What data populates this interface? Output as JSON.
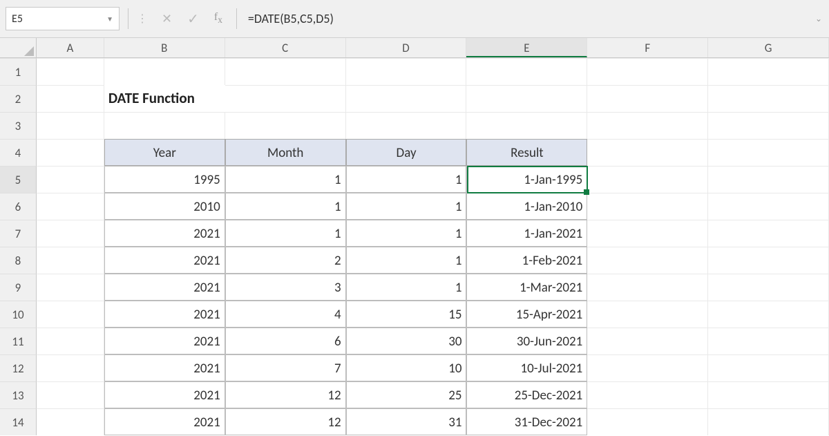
{
  "formula_bar": {
    "cell_reference": "E5",
    "formula": "=DATE(B5,C5,D5)"
  },
  "columns": [
    "A",
    "B",
    "C",
    "D",
    "E",
    "F",
    "G"
  ],
  "row_numbers": [
    "1",
    "2",
    "3",
    "4",
    "5",
    "6",
    "7",
    "8",
    "9",
    "10",
    "11",
    "12",
    "13",
    "14"
  ],
  "selected": {
    "col": "E",
    "row": "5"
  },
  "title": "DATE Function",
  "table": {
    "headers": {
      "b": "Year",
      "c": "Month",
      "d": "Day",
      "e": "Result"
    },
    "rows": [
      {
        "b": "1995",
        "c": "1",
        "d": "1",
        "e": "1-Jan-1995"
      },
      {
        "b": "2010",
        "c": "1",
        "d": "1",
        "e": "1-Jan-2010"
      },
      {
        "b": "2021",
        "c": "1",
        "d": "1",
        "e": "1-Jan-2021"
      },
      {
        "b": "2021",
        "c": "2",
        "d": "1",
        "e": "1-Feb-2021"
      },
      {
        "b": "2021",
        "c": "3",
        "d": "1",
        "e": "1-Mar-2021"
      },
      {
        "b": "2021",
        "c": "4",
        "d": "15",
        "e": "15-Apr-2021"
      },
      {
        "b": "2021",
        "c": "6",
        "d": "30",
        "e": "30-Jun-2021"
      },
      {
        "b": "2021",
        "c": "7",
        "d": "10",
        "e": "10-Jul-2021"
      },
      {
        "b": "2021",
        "c": "12",
        "d": "25",
        "e": "25-Dec-2021"
      },
      {
        "b": "2021",
        "c": "12",
        "d": "31",
        "e": "31-Dec-2021"
      }
    ]
  }
}
